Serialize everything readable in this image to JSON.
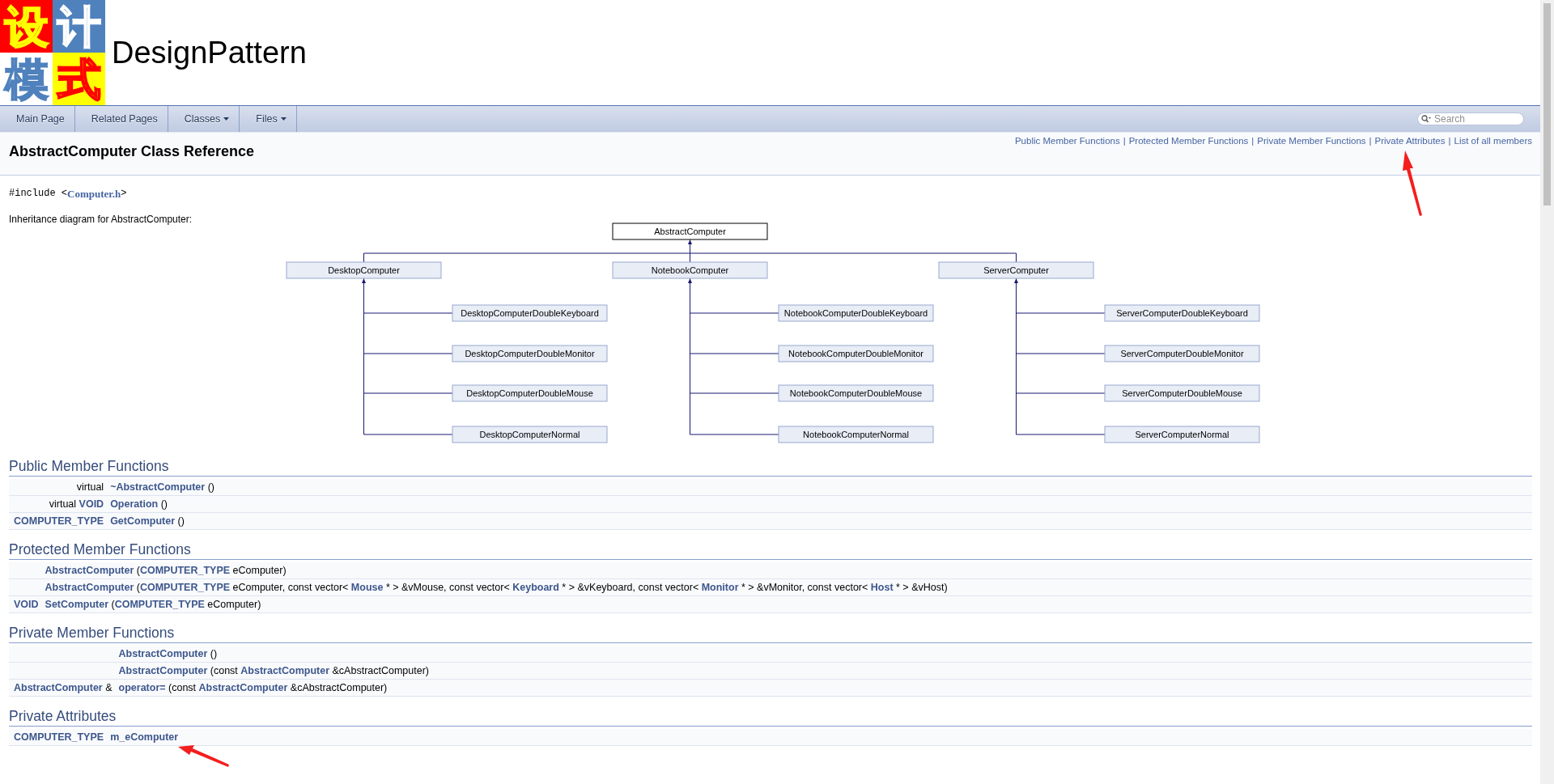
{
  "header": {
    "logo": [
      {
        "char": "设",
        "kind": "red"
      },
      {
        "char": "计",
        "kind": "blue"
      },
      {
        "char": "模",
        "kind": "white"
      },
      {
        "char": "式",
        "kind": "yellow"
      }
    ],
    "project_name": "DesignPattern"
  },
  "nav": {
    "tabs": [
      {
        "label": "Main Page",
        "dropdown": false
      },
      {
        "label": "Related Pages",
        "dropdown": false
      },
      {
        "label": "Classes",
        "dropdown": true
      },
      {
        "label": "Files",
        "dropdown": true
      }
    ],
    "search": {
      "placeholder": "Search"
    }
  },
  "summary_links": [
    {
      "text": "Public Member Functions",
      "separator": "|"
    },
    {
      "text": "Protected Member Functions",
      "separator": "|"
    },
    {
      "text": "Private Member Functions",
      "separator": "|"
    },
    {
      "text": "Private Attributes",
      "separator": "|"
    },
    {
      "text": "List of all members"
    }
  ],
  "title": "AbstractComputer Class Reference",
  "include": {
    "prefix": "#include <",
    "file": "Computer.h",
    "suffix": ">"
  },
  "inheritance_caption": "Inheritance diagram for AbstractComputer:",
  "diagram": {
    "root": "AbstractComputer",
    "branches": [
      {
        "name": "DesktopComputer",
        "children": [
          "DesktopComputerDoubleKeyboard",
          "DesktopComputerDoubleMonitor",
          "DesktopComputerDoubleMouse",
          "DesktopComputerNormal"
        ]
      },
      {
        "name": "NotebookComputer",
        "children": [
          "NotebookComputerDoubleKeyboard",
          "NotebookComputerDoubleMonitor",
          "NotebookComputerDoubleMouse",
          "NotebookComputerNormal"
        ]
      },
      {
        "name": "ServerComputer",
        "children": [
          "ServerComputerDoubleKeyboard",
          "ServerComputerDoubleMonitor",
          "ServerComputerDoubleMouse",
          "ServerComputerNormal"
        ]
      }
    ]
  },
  "sections": [
    {
      "title": "Public Member Functions",
      "rows": [
        {
          "left": "virtual",
          "right": "**~AbstractComputer** ()"
        },
        {
          "left": "virtual **VOID**",
          "right": "**Operation** ()"
        },
        {
          "left": "**COMPUTER_TYPE**",
          "right": "**GetComputer** ()"
        }
      ]
    },
    {
      "title": "Protected Member Functions",
      "rows": [
        {
          "right": "**AbstractComputer** (**COMPUTER_TYPE** eComputer)"
        },
        {
          "right": "**AbstractComputer** (**COMPUTER_TYPE** eComputer, const vector< **Mouse** * > &vMouse, const vector< **Keyboard** * > &vKeyboard, const vector< **Monitor** * > &vMonitor, const vector< **Host** * > &vHost)"
        },
        {
          "left": "**VOID**",
          "right": "**SetComputer** (**COMPUTER_TYPE** eComputer)"
        }
      ]
    },
    {
      "title": "Private Member Functions",
      "rows": [
        {
          "right": "**AbstractComputer** ()"
        },
        {
          "right": "**AbstractComputer** (const **AbstractComputer** &cAbstractComputer)"
        },
        {
          "left": "**AbstractComputer** &",
          "right": "**operator=** (const **AbstractComputer** &cAbstractComputer)"
        }
      ]
    },
    {
      "title": "Private Attributes",
      "rows": [
        {
          "left": "**COMPUTER_TYPE**",
          "right": "**m_eComputer**"
        }
      ]
    }
  ]
}
